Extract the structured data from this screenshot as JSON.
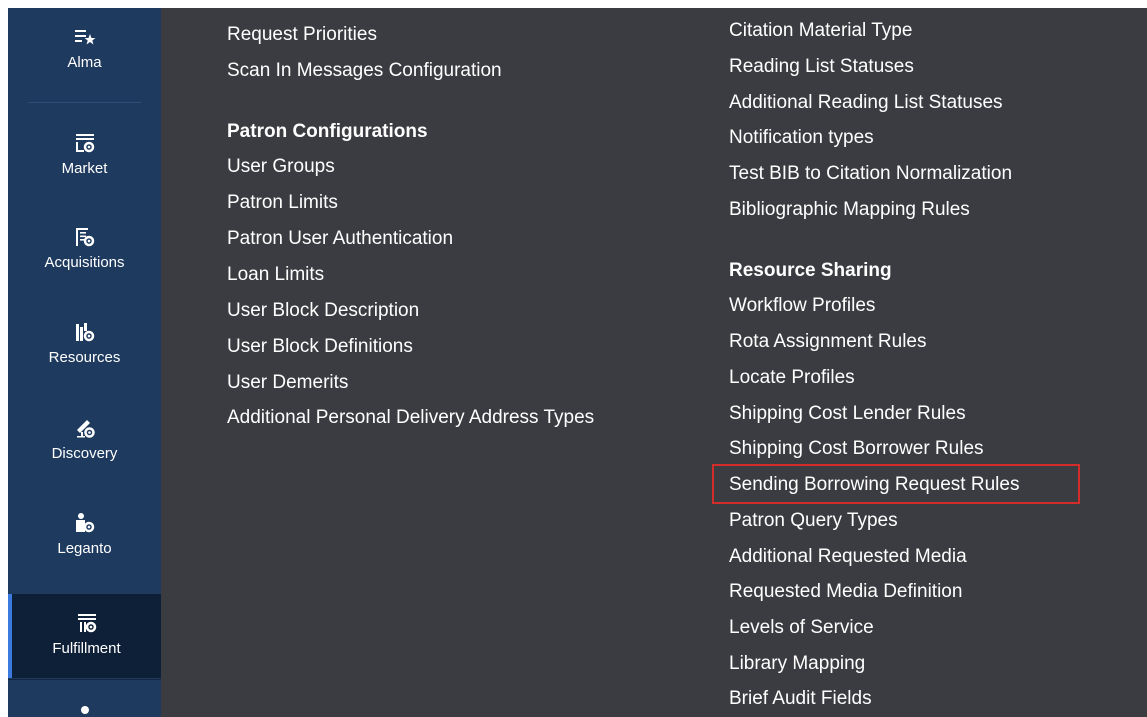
{
  "sidebar": {
    "items": [
      {
        "label": "Alma",
        "icon": "alma-star-list-icon"
      },
      {
        "label": "Market",
        "icon": "market-gear-icon"
      },
      {
        "label": "Acquisitions",
        "icon": "acquisitions-gear-icon"
      },
      {
        "label": "Resources",
        "icon": "resources-gear-icon"
      },
      {
        "label": "Discovery",
        "icon": "discovery-telescope-gear-icon"
      },
      {
        "label": "Leganto",
        "icon": "leganto-gear-icon"
      },
      {
        "label": "Fulfillment",
        "icon": "fulfillment-gear-icon",
        "active": true
      }
    ]
  },
  "left_column": {
    "items": [
      "Request Priorities",
      "Scan In Messages Configuration"
    ],
    "patron_section": {
      "heading": "Patron Configurations",
      "items": [
        "User Groups",
        "Patron Limits",
        "Patron User Authentication",
        "Loan Limits",
        "User Block Description",
        "User Block Definitions",
        "User Demerits",
        "Additional Personal Delivery Address Types"
      ]
    }
  },
  "right_column": {
    "items": [
      "Citation Material Type",
      "Reading List Statuses",
      "Additional Reading List Statuses",
      "Notification types",
      "Test BIB to Citation Normalization",
      "Bibliographic Mapping Rules"
    ],
    "resource_sharing": {
      "heading": "Resource Sharing",
      "items": [
        "Workflow Profiles",
        "Rota Assignment Rules",
        "Locate Profiles",
        "Shipping Cost Lender Rules",
        "Shipping Cost Borrower Rules",
        "Sending Borrowing Request Rules",
        "Patron Query Types",
        "Additional Requested Media",
        "Requested Media Definition",
        "Levels of Service",
        "Library Mapping",
        "Brief Audit Fields"
      ]
    }
  },
  "colors": {
    "sidebar_bg": "#1e3a5f",
    "content_bg": "#3b3c41",
    "active_item_bg": "#0e2038",
    "highlight_border": "#d42b2b"
  }
}
